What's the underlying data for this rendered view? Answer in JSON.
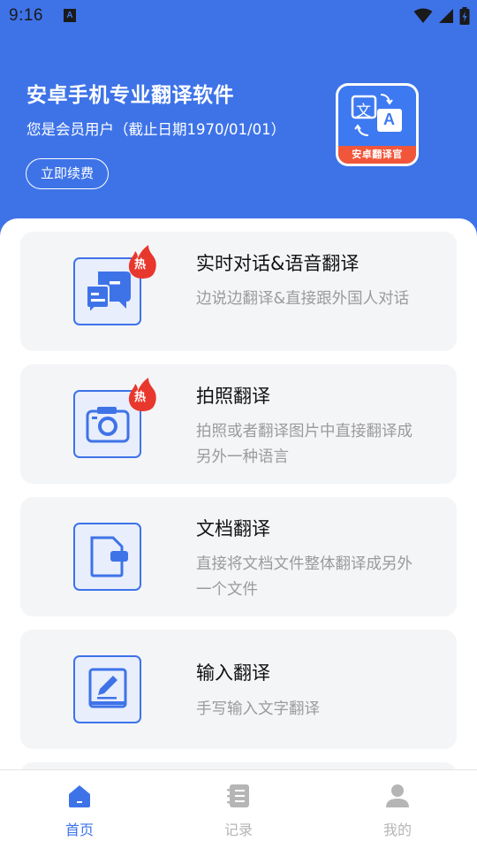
{
  "status_bar": {
    "time": "9:16",
    "notification_icon_letter": "A",
    "icons": [
      "wifi-icon",
      "signal-icon",
      "battery-icon"
    ]
  },
  "header": {
    "title": "安卓手机专业翻译软件",
    "member_status": "您是会员用户（截止日期1970/01/01）",
    "renew_button_label": "立即续费",
    "logo": {
      "text_src": "文",
      "text_dst": "A",
      "band_text": "安卓翻译官"
    },
    "background_color": "#3e73e8"
  },
  "features": [
    {
      "title": "实时对话&语音翻译",
      "description": "边说边翻译&直接跟外国人对话",
      "icon": "chat-icon",
      "hot": true,
      "hot_label": "热"
    },
    {
      "title": "拍照翻译",
      "description": "拍照或者翻译图片中直接翻译成另外一种语言",
      "icon": "camera-icon",
      "hot": true,
      "hot_label": "热"
    },
    {
      "title": "文档翻译",
      "description": "直接将文档文件整体翻译成另外一个文件",
      "icon": "document-icon",
      "hot": false
    },
    {
      "title": "输入翻译",
      "description": "手写输入文字翻译",
      "icon": "handwriting-icon",
      "hot": false
    }
  ],
  "bottom_nav": [
    {
      "label": "首页",
      "icon": "home-icon",
      "active": true
    },
    {
      "label": "记录",
      "icon": "records-icon",
      "active": false
    },
    {
      "label": "我的",
      "icon": "profile-icon",
      "active": false
    }
  ],
  "colors": {
    "accent": "#3e73e8",
    "hot_badge": "#e8372c",
    "inactive": "#b5b5b5",
    "card_bg": "#f4f5f7"
  }
}
